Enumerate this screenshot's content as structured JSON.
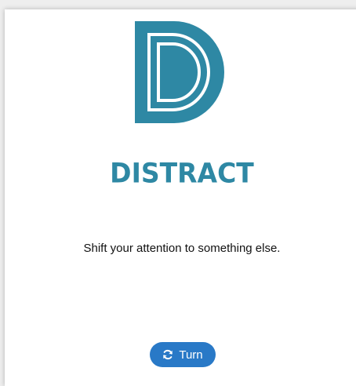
{
  "card": {
    "title": "DISTRACT",
    "message": "Shift your attention to something else."
  },
  "logo": {
    "letter": "D",
    "icon": "d-logo-icon"
  },
  "turn_button": {
    "label": "Turn",
    "icon": "refresh-icon"
  },
  "colors": {
    "accent": "#2e88a4",
    "button": "#2979c7"
  }
}
